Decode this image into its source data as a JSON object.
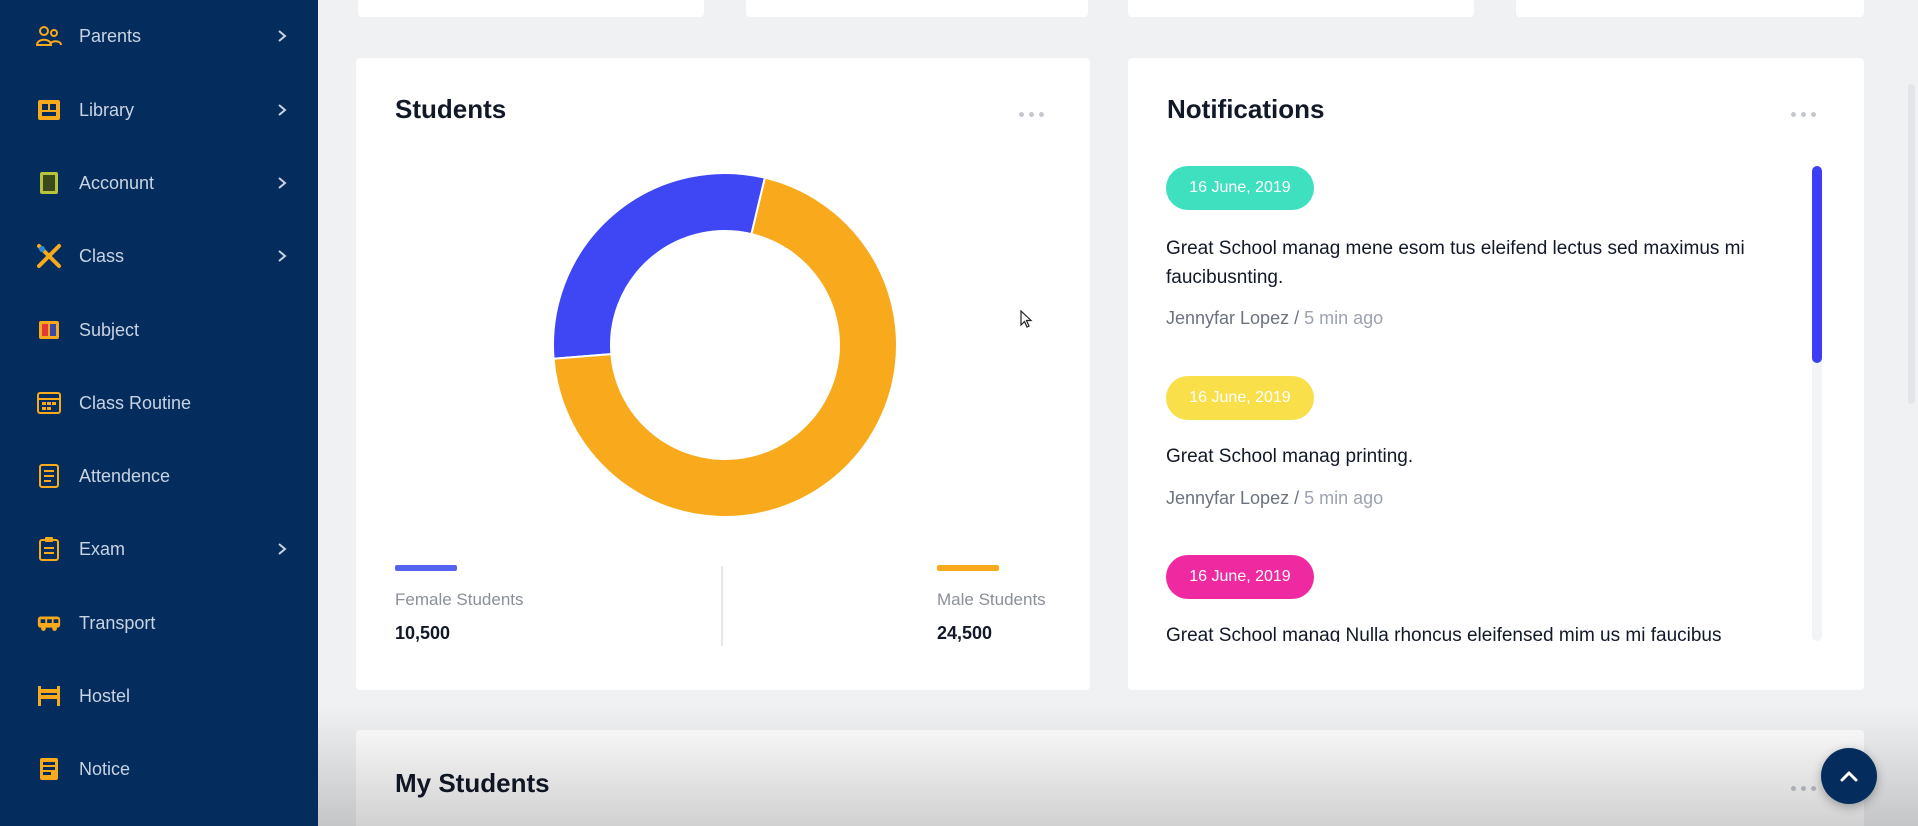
{
  "sidebar": {
    "items": [
      {
        "label": "Parents",
        "icon": "parents-icon",
        "has_submenu": true
      },
      {
        "label": "Library",
        "icon": "library-icon",
        "has_submenu": true
      },
      {
        "label": "Acconunt",
        "icon": "account-icon",
        "has_submenu": true
      },
      {
        "label": "Class",
        "icon": "class-icon",
        "has_submenu": true
      },
      {
        "label": "Subject",
        "icon": "subject-icon",
        "has_submenu": false
      },
      {
        "label": "Class Routine",
        "icon": "class-routine-icon",
        "has_submenu": false
      },
      {
        "label": "Attendence",
        "icon": "attendence-icon",
        "has_submenu": false
      },
      {
        "label": "Exam",
        "icon": "exam-icon",
        "has_submenu": true
      },
      {
        "label": "Transport",
        "icon": "transport-icon",
        "has_submenu": false
      },
      {
        "label": "Hostel",
        "icon": "hostel-icon",
        "has_submenu": false
      },
      {
        "label": "Notice",
        "icon": "notice-icon",
        "has_submenu": false
      }
    ]
  },
  "students_card": {
    "title": "Students",
    "female_label": "Female Students",
    "female_value": "10,500",
    "male_label": "Male Students",
    "male_value": "24,500"
  },
  "chart_data": {
    "type": "pie",
    "categories": [
      "Female Students",
      "Male Students"
    ],
    "values": [
      10500,
      24500
    ],
    "colors": [
      "#3f47f5",
      "#f8a91c"
    ]
  },
  "notifications_card": {
    "title": "Notifications",
    "items": [
      {
        "date": "16 June, 2019",
        "badge_color": "#3fe0c0",
        "text": "Great School manag mene esom tus eleifend lectus sed maximus mi faucibusnting.",
        "author": "Jennyfar Lopez",
        "time": "5 min ago"
      },
      {
        "date": "16 June, 2019",
        "badge_color": "#f9e04a",
        "text": "Great School manag printing.",
        "author": "Jennyfar Lopez",
        "time": "5 min ago"
      },
      {
        "date": "16 June, 2019",
        "badge_color": "#ef2aa0",
        "text": "Great School manag Nulla rhoncus eleifensed mim us mi faucibus",
        "author": "",
        "time": ""
      }
    ]
  },
  "my_students_card": {
    "title": "My Students"
  },
  "colors": {
    "sidebar_bg": "#042c5c",
    "icon_accent": "#f8a91c",
    "female": "#3f47f5",
    "male": "#f8a91c"
  }
}
